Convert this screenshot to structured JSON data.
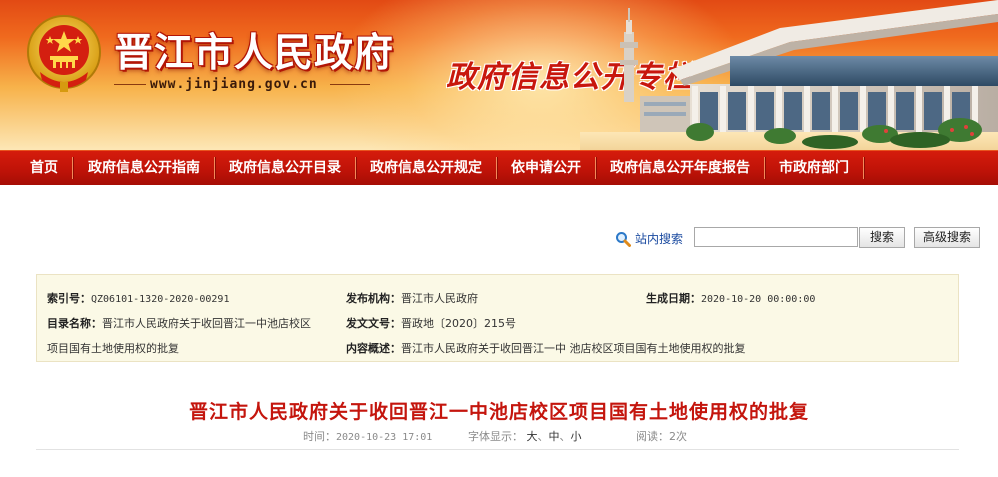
{
  "header": {
    "site_name": "晋江市人民政府",
    "site_url": "www.jinjiang.gov.cn",
    "slogan": "政府信息公开专栏"
  },
  "nav": {
    "items": [
      {
        "label": "首页"
      },
      {
        "label": "政府信息公开指南"
      },
      {
        "label": "政府信息公开目录"
      },
      {
        "label": "政府信息公开规定"
      },
      {
        "label": "依申请公开"
      },
      {
        "label": "政府信息公开年度报告"
      },
      {
        "label": "市政府部门"
      }
    ]
  },
  "search": {
    "link_label": "站内搜索",
    "input_value": "",
    "button_label": "搜索",
    "advanced_label": "高级搜索"
  },
  "meta": {
    "index_no_label": "索引号：",
    "index_no": "QZ06101-1320-2020-00291",
    "publisher_label": "发布机构：",
    "publisher": "晋江市人民政府",
    "created_label": "生成日期：",
    "created": "2020-10-20 00:00:00",
    "catalog_label": "目录名称：",
    "catalog_line1": "晋江市人民政府关于收回晋江一中池店校区",
    "catalog_line2": "项目国有土地使用权的批复",
    "doc_no_label": "发文文号：",
    "doc_no": "晋政地〔2020〕215号",
    "summary_label": "内容概述：",
    "summary": "晋江市人民政府关于收回晋江一中 池店校区项目国有土地使用权的批复"
  },
  "article": {
    "title": "晋江市人民政府关于收回晋江一中池店校区项目国有土地使用权的批复",
    "time_label": "时间：",
    "time": "2020-10-23 17:01",
    "font_label": "字体显示：",
    "font_large": "大",
    "font_mid": "中",
    "font_small": "小",
    "sep1": "、",
    "sep2": "、",
    "reads_label": "阅读：",
    "reads": "2次"
  },
  "colors": {
    "nav_red": "#c01308",
    "title_red": "#c4150d",
    "meta_bg": "#fbf9e6"
  }
}
